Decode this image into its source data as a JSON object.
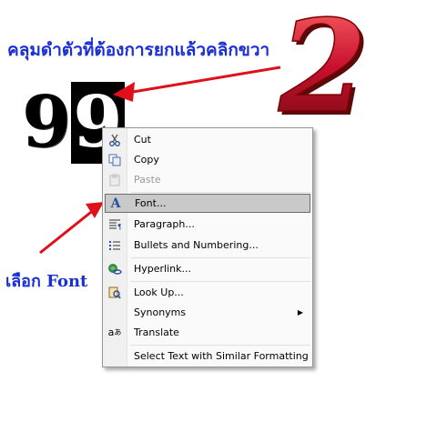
{
  "instruction_top": "คลุมดำตัวที่ต้องการยกแล้วคลิกขวา",
  "instruction_bottom": "เลือก Font",
  "step_number": "2",
  "selected_text": {
    "plain": "9",
    "selected": "9"
  },
  "context_menu": {
    "items": [
      {
        "label": "Cut",
        "icon": "scissors-icon",
        "enabled": true
      },
      {
        "label": "Copy",
        "icon": "copy-icon",
        "enabled": true
      },
      {
        "label": "Paste",
        "icon": "paste-icon",
        "enabled": false
      },
      {
        "label": "Font...",
        "icon": "font-icon",
        "enabled": true,
        "highlighted": true
      },
      {
        "label": "Paragraph...",
        "icon": "paragraph-icon",
        "enabled": true
      },
      {
        "label": "Bullets and Numbering...",
        "icon": "bullets-icon",
        "enabled": true
      },
      {
        "label": "Hyperlink...",
        "icon": "hyperlink-icon",
        "enabled": true
      },
      {
        "label": "Look Up...",
        "icon": "lookup-icon",
        "enabled": true
      },
      {
        "label": "Synonyms",
        "icon": "",
        "enabled": true,
        "submenu": true
      },
      {
        "label": "Translate",
        "icon": "translate-icon",
        "enabled": true
      },
      {
        "label": "Select Text with Similar Formatting",
        "icon": "",
        "enabled": true
      }
    ]
  },
  "colors": {
    "annotation_blue": "#1a2fd6",
    "arrow_red": "#e0101a",
    "number_red": "#c8102e"
  }
}
